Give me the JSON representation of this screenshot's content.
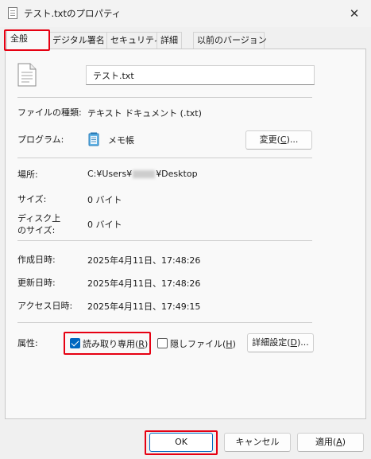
{
  "window": {
    "title": "テスト.txtのプロパティ",
    "close_glyph": "✕"
  },
  "tabs": [
    {
      "label": "全般",
      "active": true
    },
    {
      "label": "デジタル署名",
      "active": false
    },
    {
      "label": "セキュリティ",
      "active": false
    },
    {
      "label": "詳細",
      "active": false
    },
    {
      "label": "以前のバージョン",
      "active": false
    }
  ],
  "general": {
    "filename": "テスト.txt",
    "file_type_label": "ファイルの種類:",
    "file_type_value": "テキスト ドキュメント (.txt)",
    "program_label": "プログラム:",
    "program_value": "メモ帳",
    "change_button_prefix": "変更(",
    "change_button_key": "C",
    "change_button_suffix": ")...",
    "location_label": "場所:",
    "location_prefix": "C:¥Users¥",
    "location_suffix": "¥Desktop",
    "size_label": "サイズ:",
    "size_value": "0 バイト",
    "disk_size_label_line1": "ディスク上",
    "disk_size_label_line2": "のサイズ:",
    "disk_size_value": "0 バイト",
    "created_label": "作成日時:",
    "created_value": "2025年4月11日、17:48:26",
    "modified_label": "更新日時:",
    "modified_value": "2025年4月11日、17:48:26",
    "accessed_label": "アクセス日時:",
    "accessed_value": "2025年4月11日、17:49:15",
    "attributes_label": "属性:",
    "readonly_label_prefix": "読み取り専用(",
    "readonly_key": "R",
    "readonly_label_suffix": ")",
    "readonly_checked": true,
    "hidden_label_prefix": "隠しファイル(",
    "hidden_key": "H",
    "hidden_label_suffix": ")",
    "hidden_checked": false,
    "advanced_button_prefix": "詳細設定(",
    "advanced_button_key": "D",
    "advanced_button_suffix": ")..."
  },
  "footer": {
    "ok_label": "OK",
    "cancel_label": "キャンセル",
    "apply_prefix": "適用(",
    "apply_key": "A",
    "apply_suffix": ")"
  },
  "colors": {
    "highlight": "#e60012",
    "accent": "#0067c0"
  },
  "icons": {
    "title": "text-file-icon",
    "file": "text-document-icon",
    "program": "notepad-icon",
    "close": "close-icon"
  }
}
